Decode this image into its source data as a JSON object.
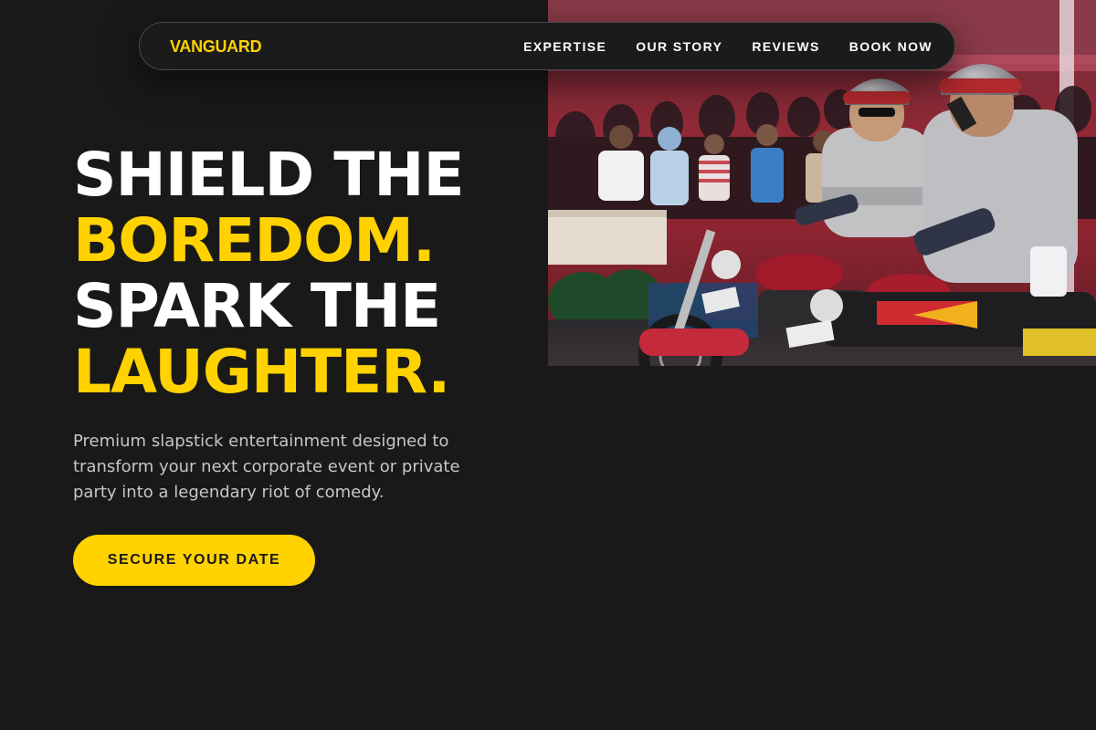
{
  "brand": {
    "name": "VANGUARD",
    "accent_color": "#ffd200",
    "background_color": "#191919"
  },
  "nav": {
    "links": [
      "EXPERTISE",
      "OUR STORY",
      "REVIEWS",
      "BOOK NOW"
    ]
  },
  "hero": {
    "headline": {
      "line1": "SHIELD THE",
      "line2": "BOREDOM.",
      "line3": "SPARK THE",
      "line4": "LAUGHTER."
    },
    "subtext": "Premium slapstick entertainment designed to transform your next corporate event or private party into a legendary riot of comedy.",
    "cta_label": "SECURE YOUR DATE",
    "image_icon": "hero-photo-motorcycle-escort"
  }
}
